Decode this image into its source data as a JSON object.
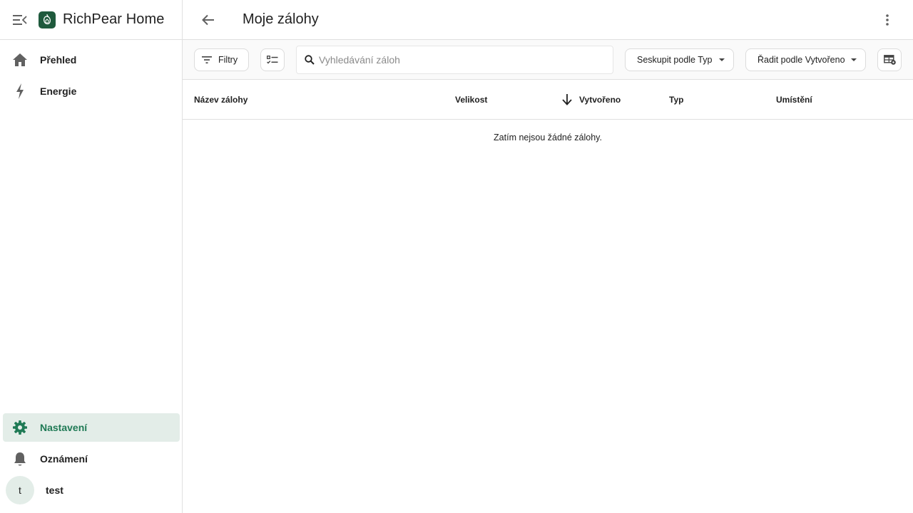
{
  "app": {
    "brand": "RichPear Home"
  },
  "sidebar": {
    "items": [
      {
        "label": "Přehled",
        "icon": "home-icon"
      },
      {
        "label": "Energie",
        "icon": "lightning-icon"
      }
    ],
    "bottom": [
      {
        "label": "Nastavení",
        "icon": "gear-icon",
        "active": true
      },
      {
        "label": "Oznámení",
        "icon": "bell-icon"
      }
    ],
    "user": {
      "initial": "t",
      "name": "test"
    }
  },
  "header": {
    "title": "Moje zálohy"
  },
  "toolbar": {
    "filters_label": "Filtry",
    "search_placeholder": "Vyhledávání záloh",
    "group_label": "Seskupit podle Typ",
    "sort_label": "Řadit podle Vytvořeno"
  },
  "table": {
    "columns": [
      "Název zálohy",
      "Velikost",
      "Vytvořeno",
      "Typ",
      "Umístění"
    ],
    "empty_message": "Zatím nejsou žádné zálohy."
  },
  "colors": {
    "accent": "#1f7a55",
    "active_bg": "#e3ede8",
    "logo_bg": "#1f5a3d"
  }
}
